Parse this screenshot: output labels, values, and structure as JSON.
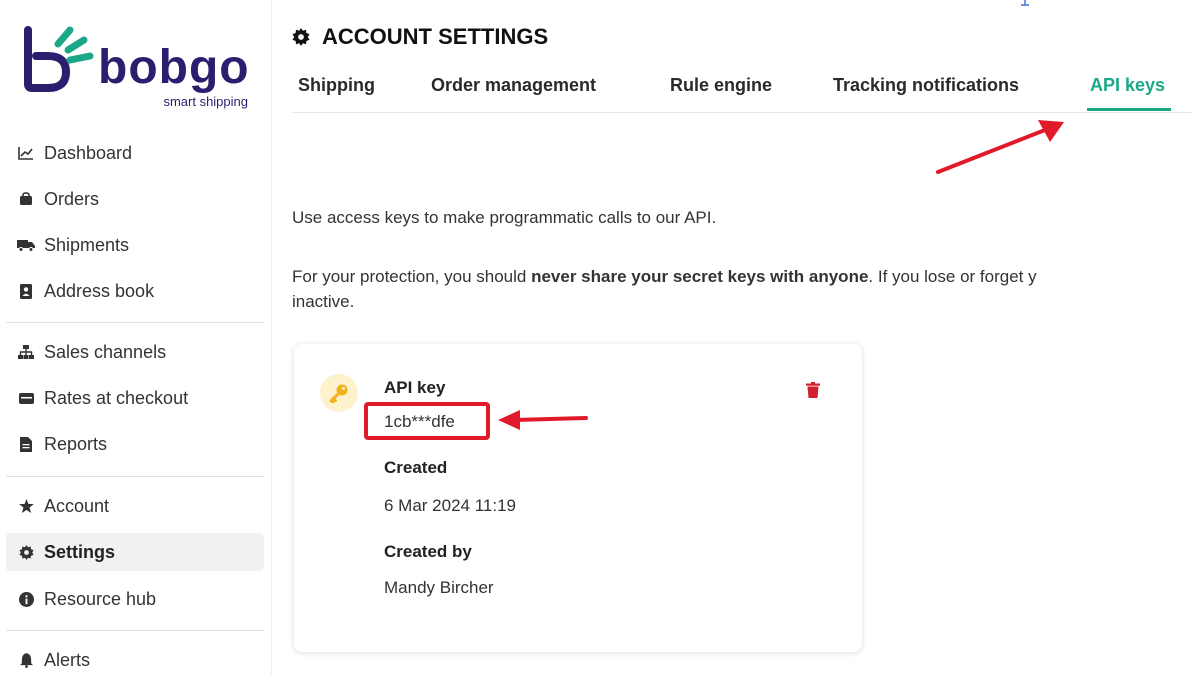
{
  "brand": {
    "name": "bobgo",
    "tagline": "smart shipping",
    "color": "#2a1f6e"
  },
  "sidebar": {
    "items": [
      {
        "label": "Dashboard",
        "icon": "chart-line-icon"
      },
      {
        "label": "Orders",
        "icon": "bag-icon"
      },
      {
        "label": "Shipments",
        "icon": "truck-icon"
      },
      {
        "label": "Address book",
        "icon": "address-book-icon"
      },
      {
        "label": "Sales channels",
        "icon": "sitemap-icon"
      },
      {
        "label": "Rates at checkout",
        "icon": "cart-icon"
      },
      {
        "label": "Reports",
        "icon": "report-icon"
      },
      {
        "label": "Account",
        "icon": "star-icon"
      },
      {
        "label": "Settings",
        "icon": "gear-icon",
        "active": true
      },
      {
        "label": "Resource hub",
        "icon": "info-icon"
      },
      {
        "label": "Alerts",
        "icon": "bell-icon"
      }
    ]
  },
  "header": {
    "title": "ACCOUNT SETTINGS"
  },
  "tabs": [
    {
      "label": "Shipping"
    },
    {
      "label": "Order management"
    },
    {
      "label": "Rule engine"
    },
    {
      "label": "Tracking notifications"
    },
    {
      "label": "API keys",
      "active": true
    }
  ],
  "content": {
    "intro": "Use access keys to make programmatic calls to our API.",
    "warning_prefix": "For your protection, you should ",
    "warning_bold": "never share your secret keys with anyone",
    "warning_suffix": ". If you lose or forget y",
    "warning_line2": "inactive."
  },
  "api_key_card": {
    "key_label": "API key",
    "key_value": "1cb***dfe",
    "created_label": "Created",
    "created_value": "6 Mar 2024 11:19",
    "created_by_label": "Created by",
    "created_by_value": "Mandy Bircher"
  },
  "colors": {
    "accent": "#1aa888",
    "annotation_red": "#e11a2b",
    "delete_red": "#d0202e",
    "key_yellow": "#f2b21a"
  }
}
